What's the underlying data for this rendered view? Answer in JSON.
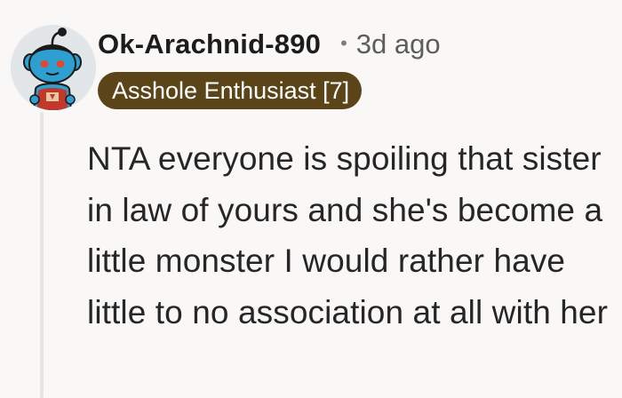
{
  "comment": {
    "username": "Ok-Arachnid-890",
    "separator": "•",
    "timestamp": "3d ago",
    "flair": "Asshole Enthusiast [7]",
    "body": "NTA everyone is spoiling that sister in law of yours and she's become a little monster I would rather have little to no association at all with her"
  },
  "colors": {
    "flair_background": "#5b4518",
    "avatar_skin": "#2d9fd1",
    "thread_line": "#e5e5e5"
  },
  "icons": {
    "avatar": "snoo-avatar-icon"
  }
}
